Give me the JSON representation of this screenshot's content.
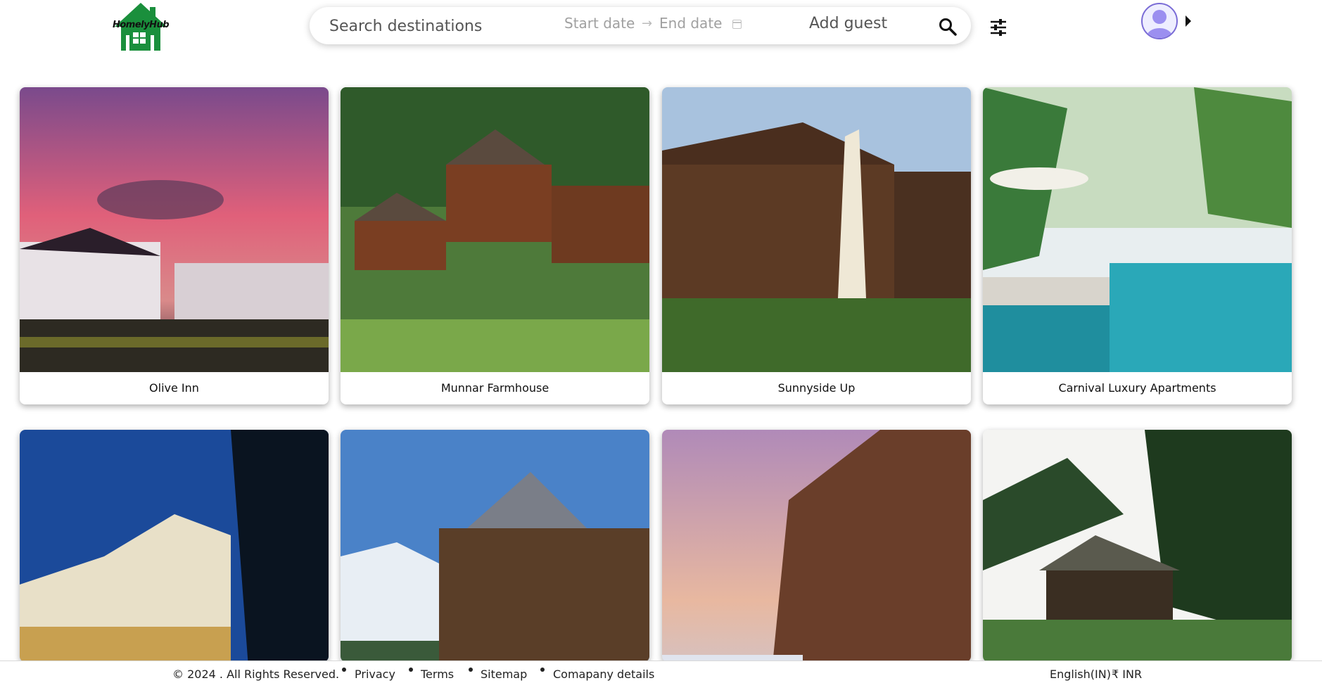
{
  "header": {
    "logo_text": "HomelyHub",
    "search_placeholder": "Search destinations",
    "start_date": "Start date",
    "end_date": "End date",
    "date_arrow": "→",
    "guest_placeholder": "Add guest",
    "icons": {
      "search": "search-icon",
      "filter": "sliders-icon",
      "avatar": "user-avatar-icon",
      "menu": "caret-right-icon",
      "calendar": "calendar-icon"
    },
    "colors": {
      "logo_green": "#1a8f3c",
      "avatar_ring": "#7a6cd6",
      "avatar_fill": "#9b8ff0"
    }
  },
  "listings": [
    {
      "title": "Olive Inn",
      "image": "sunset-hotel-photo"
    },
    {
      "title": "Munnar Farmhouse",
      "image": "wooden-stilt-houses-photo"
    },
    {
      "title": "Sunnyside Up",
      "image": "alpine-chalet-photo"
    },
    {
      "title": "Carnival Luxury Apartments",
      "image": "tropical-pool-resort-photo"
    },
    {
      "title": "",
      "image": "night-hotel-photo"
    },
    {
      "title": "",
      "image": "mountain-lodge-photo"
    },
    {
      "title": "",
      "image": "wooden-chalet-dusk-photo"
    },
    {
      "title": "",
      "image": "forest-hut-photo"
    }
  ],
  "footer": {
    "copyright": "© 2024 . All Rights Reserved.",
    "links": [
      "Privacy",
      "Terms",
      "Sitemap",
      "Comapany details"
    ],
    "locale": "English(IN)",
    "currency": "₹ INR"
  }
}
